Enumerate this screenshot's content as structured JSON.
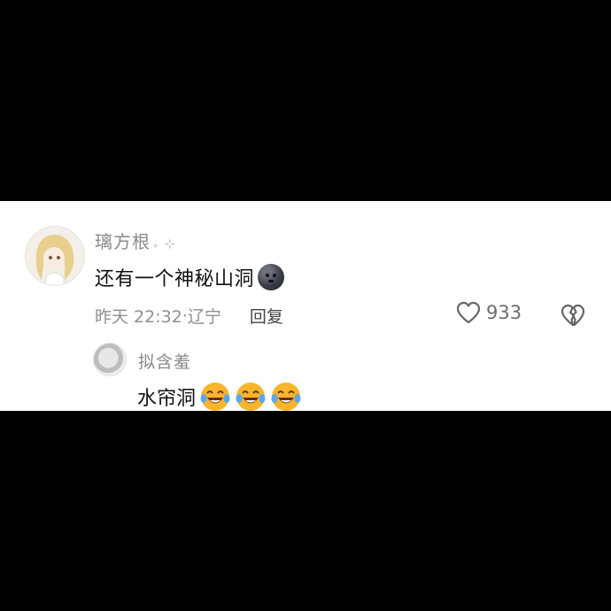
{
  "comment": {
    "username": "璃方根",
    "username_sparkle": "₊ ⊹",
    "text": "还有一个神秘山洞",
    "emoji_name": "new-moon-face-emoji",
    "time": "昨天 22:32",
    "location_sep": "·",
    "location": "辽宁",
    "reply_label": "回复",
    "like_count": "933"
  },
  "reply": {
    "username": "拟含羞",
    "text": "水帘洞",
    "emoji_name": "tears-of-joy-emoji",
    "emoji_count": 3
  },
  "colors": {
    "background": "#000000",
    "panel": "#ffffff",
    "meta_text": "#8f8f8f",
    "joy_emoji": "#f7b52c"
  }
}
